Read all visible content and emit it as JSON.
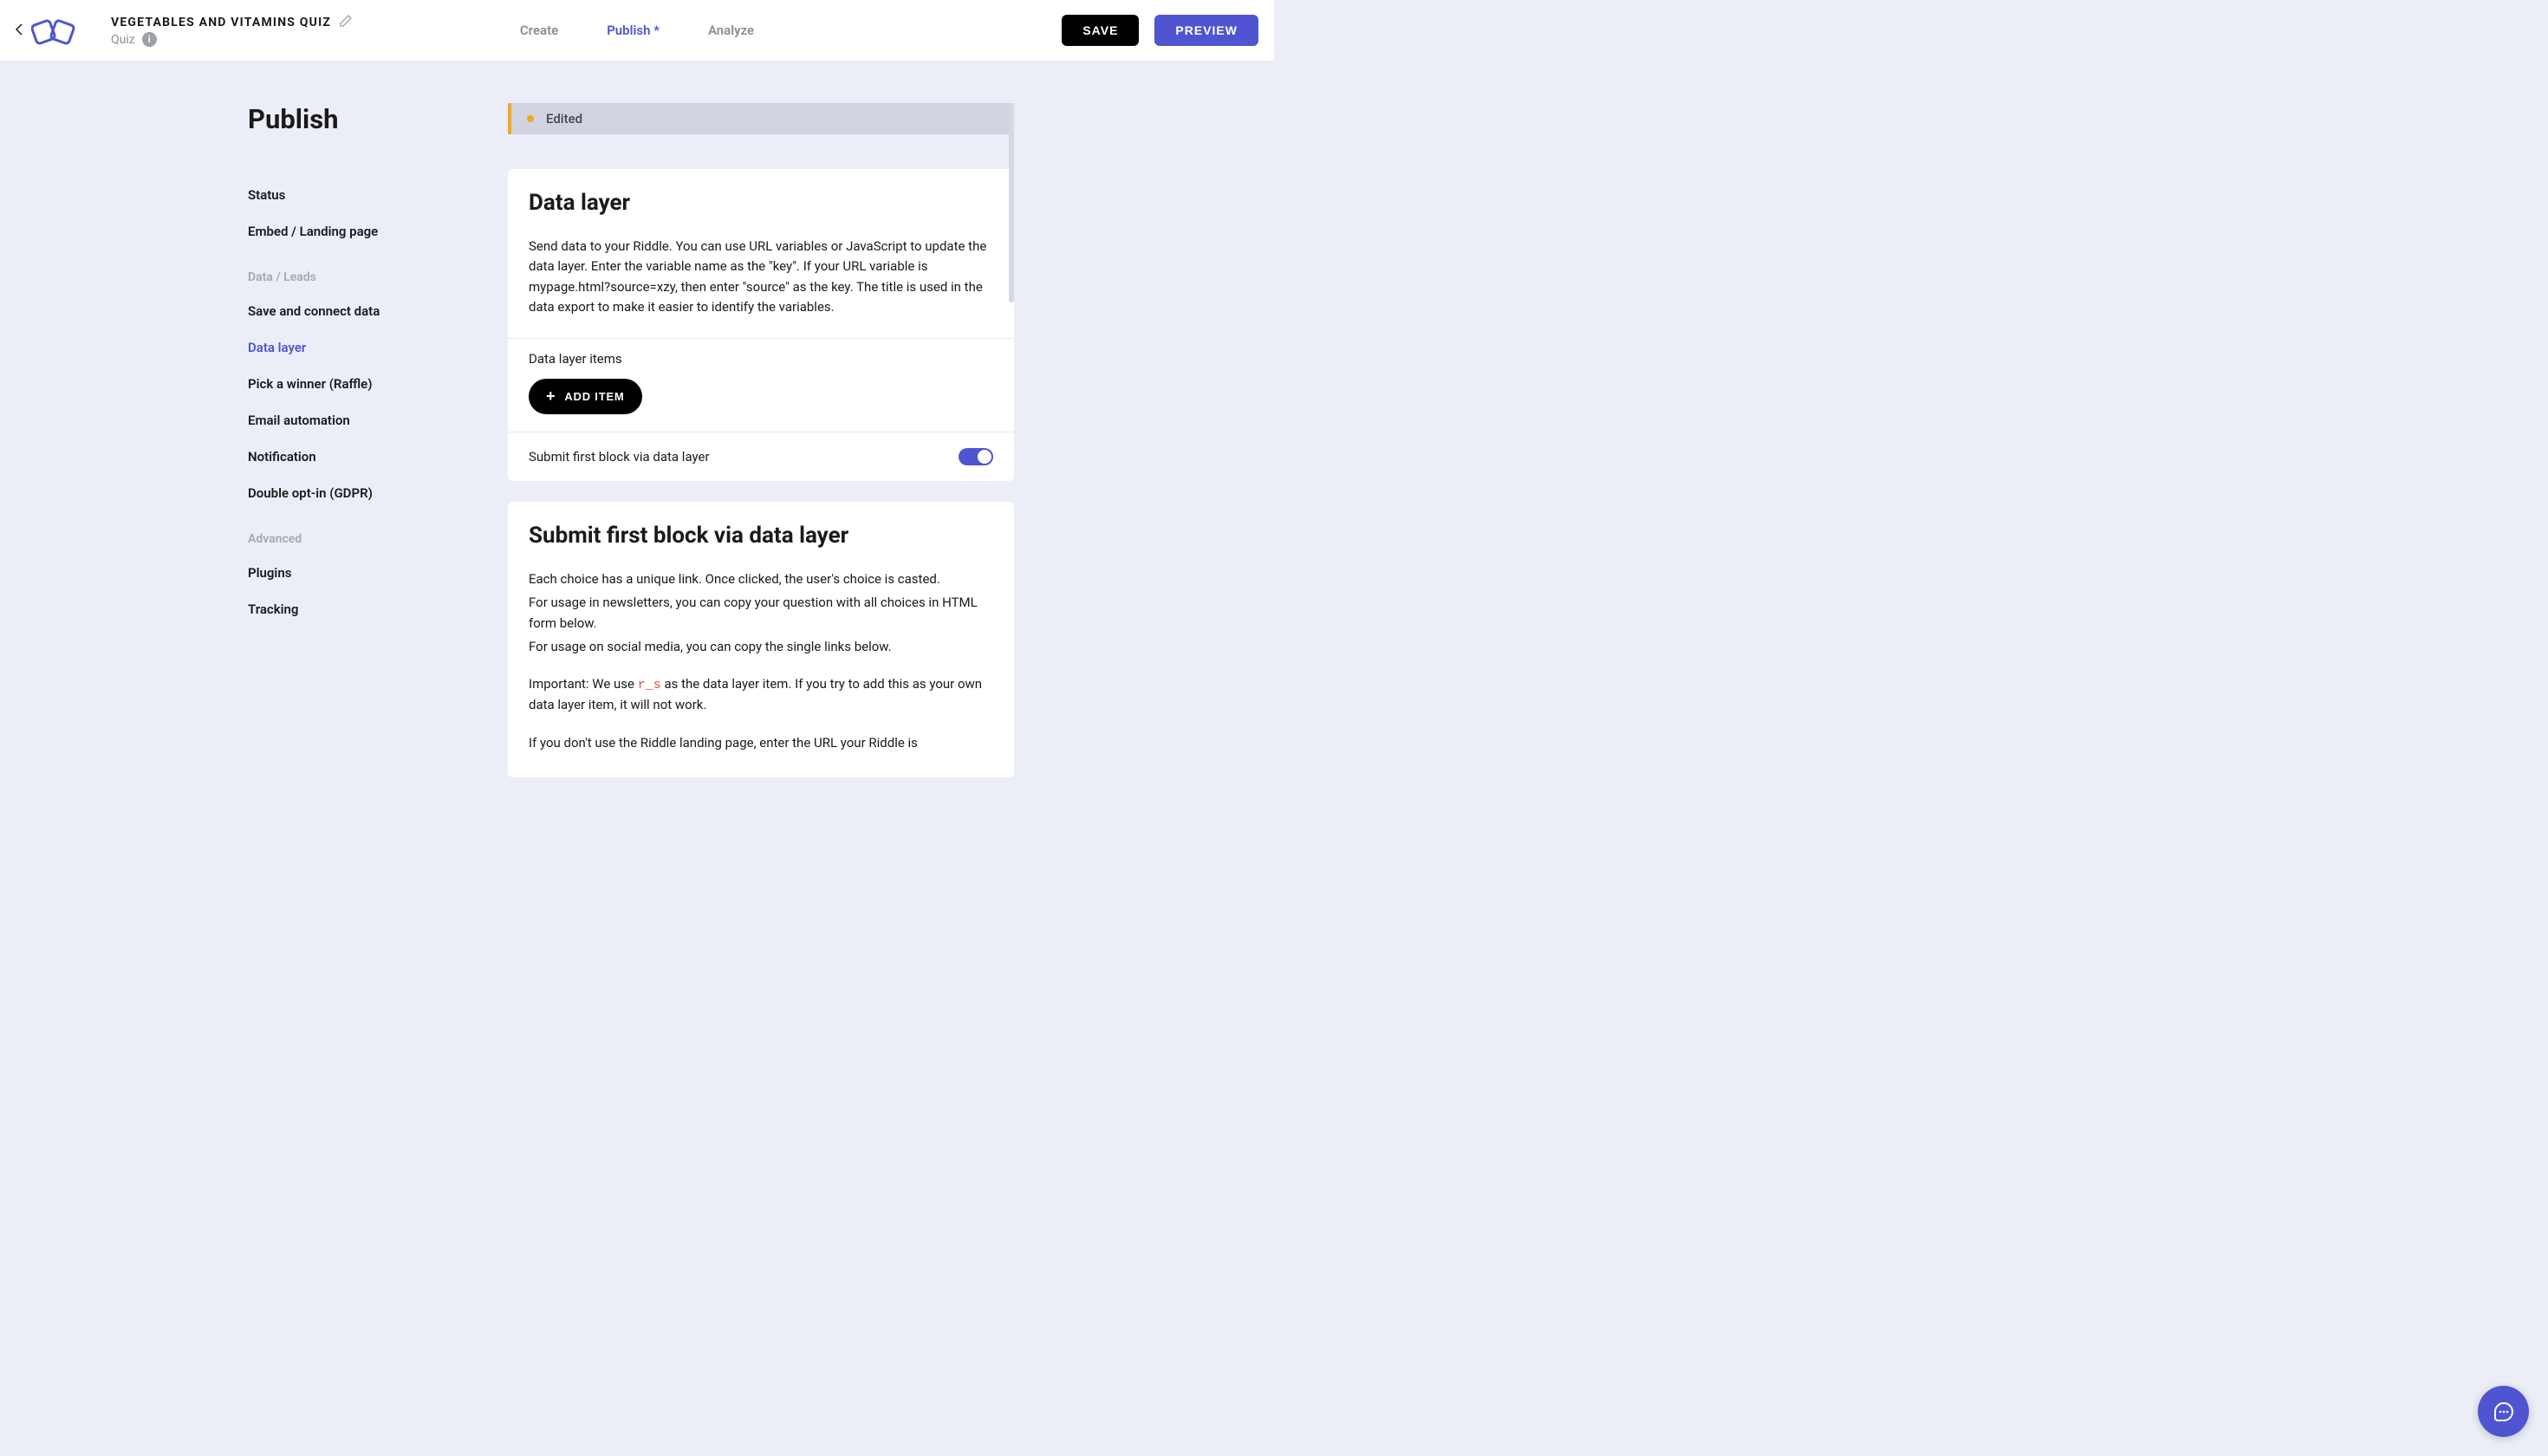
{
  "header": {
    "title": "VEGETABLES AND VITAMINS QUIZ",
    "subtitle": "Quiz",
    "nav": {
      "create": "Create",
      "publish": "Publish *",
      "analyze": "Analyze"
    },
    "save": "SAVE",
    "preview": "PREVIEW"
  },
  "sidebar": {
    "title": "Publish",
    "items": {
      "status": "Status",
      "embed": "Embed / Landing page",
      "dataLeadsHeading": "Data / Leads",
      "saveConnect": "Save and connect data",
      "dataLayer": "Data layer",
      "pickWinner": "Pick a winner (Raffle)",
      "emailAutomation": "Email automation",
      "notification": "Notification",
      "doubleOptIn": "Double opt-in (GDPR)",
      "advancedHeading": "Advanced",
      "plugins": "Plugins",
      "tracking": "Tracking"
    }
  },
  "statusBanner": {
    "text": "Edited"
  },
  "dataLayerCard": {
    "title": "Data layer",
    "desc": "Send data to your Riddle. You can use URL variables or JavaScript to update the data layer. Enter the variable name as the \"key\". If your URL variable is mypage.html?source=xzy, then enter \"source\" as the key. The title is used in the data export to make it easier to identify the variables.",
    "subsectionLabel": "Data layer items",
    "addItem": "ADD ITEM",
    "toggleLabel": "Submit first block via data layer"
  },
  "submitCard": {
    "title": "Submit first block via data layer",
    "p1": "Each choice has a unique link. Once clicked, the user's choice is casted.",
    "p2": "For usage in newsletters, you can copy your question with all choices in HTML form below.",
    "p3": "For usage on social media, you can copy the single links below.",
    "p4a": "Important: We use ",
    "p4code": "r_s",
    "p4b": " as the data layer item. If you try to add this as your own data layer item, it will not work.",
    "p5": "If you don't use the Riddle landing page, enter the URL your Riddle is"
  }
}
